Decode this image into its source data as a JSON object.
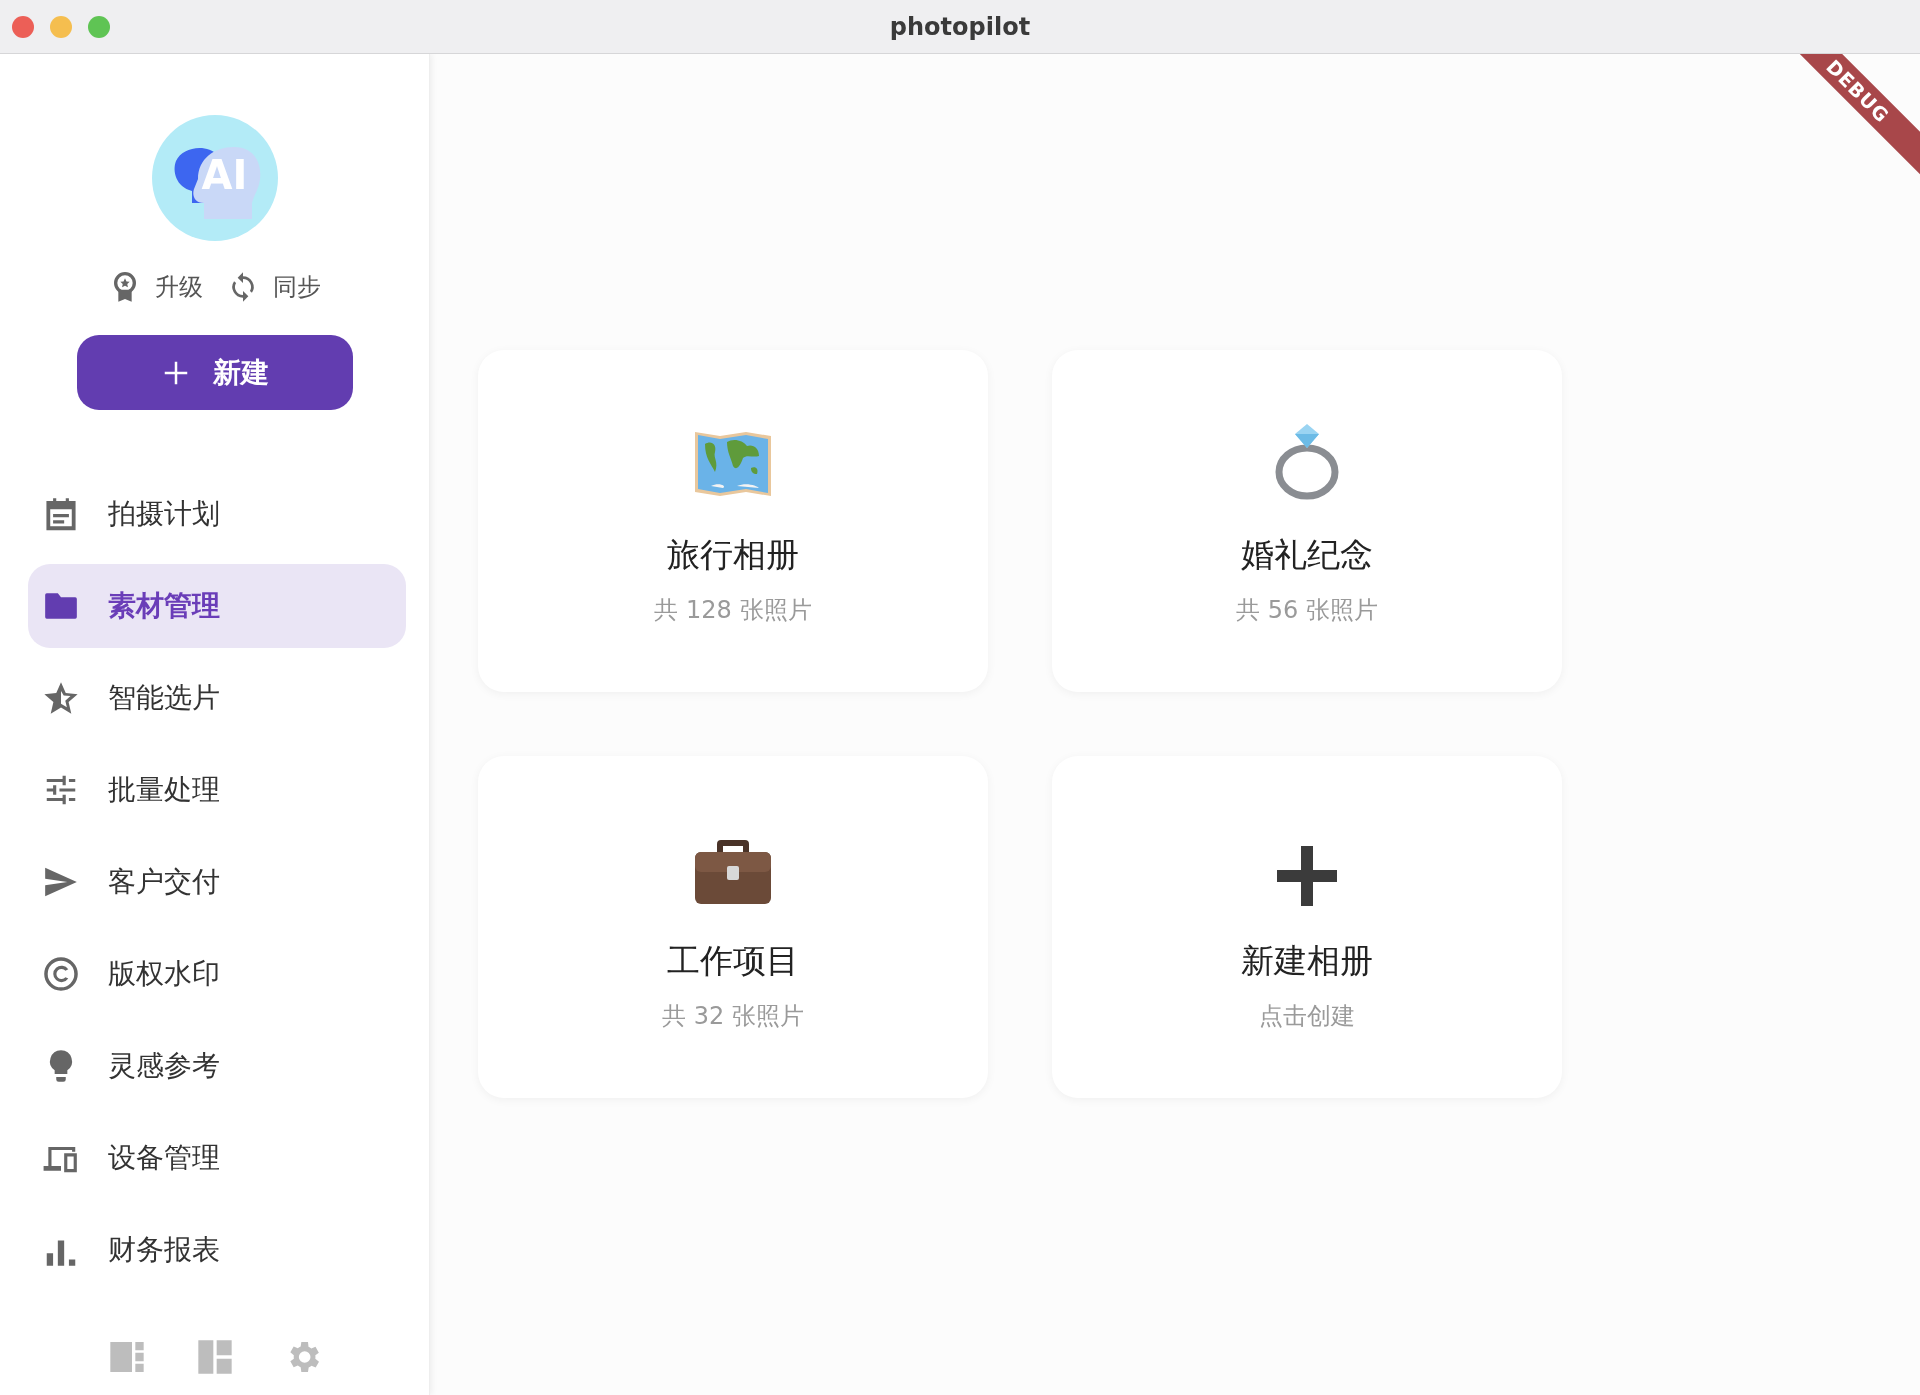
{
  "window": {
    "title": "photopilot"
  },
  "debug_banner": "DEBUG",
  "sidebar": {
    "logo": "AI",
    "actions": [
      {
        "label": "升级"
      },
      {
        "label": "同步"
      }
    ],
    "new_button": "新建",
    "items": [
      {
        "label": "拍摄计划",
        "selected": false
      },
      {
        "label": "素材管理",
        "selected": true
      },
      {
        "label": "智能选片",
        "selected": false
      },
      {
        "label": "批量处理",
        "selected": false
      },
      {
        "label": "客户交付",
        "selected": false
      },
      {
        "label": "版权水印",
        "selected": false
      },
      {
        "label": "灵感参考",
        "selected": false
      },
      {
        "label": "设备管理",
        "selected": false
      },
      {
        "label": "财务报表",
        "selected": false
      }
    ]
  },
  "albums": [
    {
      "title": "旅行相册",
      "subtitle": "共 128 张照片"
    },
    {
      "title": "婚礼纪念",
      "subtitle": "共 56 张照片"
    },
    {
      "title": "工作项目",
      "subtitle": "共 32 张照片"
    },
    {
      "title": "新建相册",
      "subtitle": "点击创建"
    }
  ]
}
